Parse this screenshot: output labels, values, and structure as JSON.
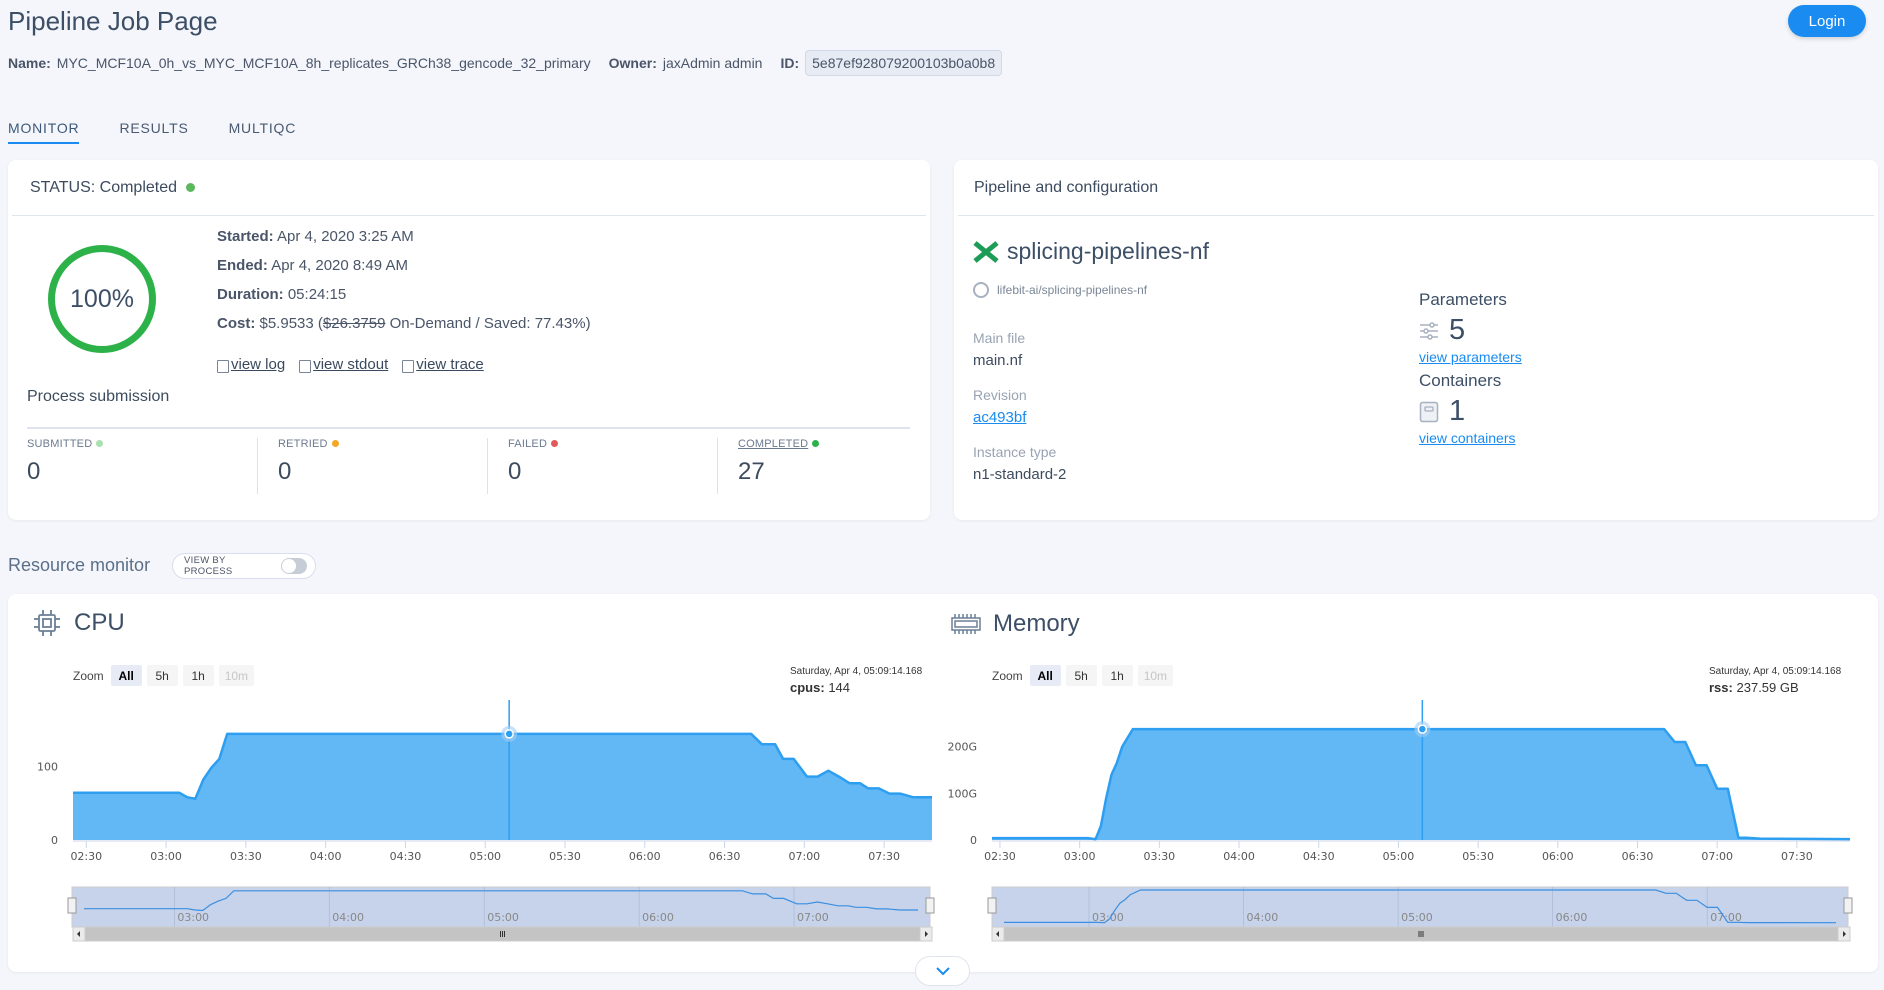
{
  "header": {
    "title": "Pipeline Job Page",
    "name_label": "Name:",
    "name_value": "MYC_MCF10A_0h_vs_MYC_MCF10A_8h_replicates_GRCh38_gencode_32_primary",
    "owner_label": "Owner:",
    "owner_value": "jaxAdmin admin",
    "id_label": "ID:",
    "id_value": "5e87ef928079200103b0a0b8",
    "login_label": "Login"
  },
  "tabs": [
    {
      "label": "MONITOR",
      "active": true
    },
    {
      "label": "RESULTS",
      "active": false
    },
    {
      "label": "MULTIQC",
      "active": false
    }
  ],
  "status": {
    "title": "STATUS: Completed",
    "status_color": "#5cb85c",
    "progress_percent": 100,
    "progress_label": "100%",
    "started_label": "Started:",
    "started_value": "Apr 4, 2020 3:25 AM",
    "ended_label": "Ended:",
    "ended_value": "Apr 4, 2020 8:49 AM",
    "duration_label": "Duration:",
    "duration_value": "05:24:15",
    "cost_label": "Cost:",
    "cost_value": "$5.9533 (",
    "cost_ondemand": "$26.3759",
    "cost_suffix": " On-Demand / Saved: 77.43%)",
    "links": [
      "view log",
      "view stdout",
      "view trace"
    ],
    "process_title": "Process submission",
    "counters": [
      {
        "label": "SUBMITTED",
        "value": "0",
        "color": "#a8e0b0"
      },
      {
        "label": "RETRIED",
        "value": "0",
        "color": "#f5a623"
      },
      {
        "label": "FAILED",
        "value": "0",
        "color": "#e05a5a"
      },
      {
        "label": "COMPLETED",
        "value": "27",
        "color": "#2db24a"
      }
    ]
  },
  "pipeline": {
    "card_title": "Pipeline and configuration",
    "name": "splicing-pipelines-nf",
    "repo": "lifebit-ai/splicing-pipelines-nf",
    "main_file_label": "Main file",
    "main_file_value": "main.nf",
    "revision_label": "Revision",
    "revision_value": "ac493bf",
    "instance_label": "Instance type",
    "instance_value": "n1-standard-2",
    "parameters_title": "Parameters",
    "parameters_count": "5",
    "parameters_link": "view parameters",
    "containers_title": "Containers",
    "containers_count": "1",
    "containers_link": "view containers"
  },
  "resource_monitor": {
    "title": "Resource monitor",
    "view_by_process_label": "VIEW BY PROCESS",
    "view_by_process_on": false,
    "zoom_label": "Zoom",
    "zoom_buttons": [
      "All",
      "5h",
      "1h",
      "10m"
    ],
    "zoom_selected": "All"
  },
  "chart_data": [
    {
      "type": "area",
      "title": "CPU",
      "xlabel": "",
      "ylabel": "",
      "x_ticks": [
        "02:30",
        "03:00",
        "03:30",
        "04:00",
        "04:30",
        "05:00",
        "05:30",
        "06:00",
        "06:30",
        "07:00",
        "07:30"
      ],
      "y_ticks": [
        "0",
        "100"
      ],
      "y_tick_values": [
        0,
        100
      ],
      "ylim": [
        0,
        190
      ],
      "xlim_minutes": [
        145,
        468
      ],
      "x_minutes": [
        145,
        185,
        188,
        191,
        194,
        197,
        200,
        203,
        206,
        212,
        400,
        404,
        409,
        412,
        416,
        421,
        425,
        429,
        433,
        437,
        441,
        444,
        448,
        452,
        456,
        461,
        463,
        468
      ],
      "values": [
        64,
        64,
        58,
        56,
        82,
        98,
        110,
        144,
        144,
        144,
        144,
        130,
        130,
        110,
        110,
        86,
        86,
        94,
        86,
        77,
        77,
        70,
        70,
        63,
        63,
        58,
        58,
        58
      ],
      "tooltip": {
        "date": "Saturday, Apr 4, 05:09:14.168",
        "series": "cpus",
        "value": "144"
      },
      "crosshair_minutes": 309,
      "navigator_ticks": [
        "03:00",
        "04:00",
        "05:00",
        "06:00",
        "07:00"
      ],
      "color": "#2e9ff0",
      "fill": "#62b7f5"
    },
    {
      "type": "area",
      "title": "Memory",
      "xlabel": "",
      "ylabel": "",
      "x_ticks": [
        "02:30",
        "03:00",
        "03:30",
        "04:00",
        "04:30",
        "05:00",
        "05:30",
        "06:00",
        "06:30",
        "07:00",
        "07:30"
      ],
      "y_ticks": [
        "0",
        "100G",
        "200G"
      ],
      "y_tick_values": [
        0,
        100,
        200
      ],
      "ylim": [
        0,
        300
      ],
      "xlim_minutes": [
        147,
        470
      ],
      "x_minutes": [
        147,
        183,
        186,
        188,
        190,
        192,
        194,
        196,
        200,
        203,
        206,
        400,
        404,
        408,
        412,
        416,
        420,
        424,
        428,
        431,
        436,
        470
      ],
      "values": [
        4,
        4,
        2,
        30,
        90,
        140,
        165,
        200,
        237.59,
        237.59,
        237.59,
        237.59,
        210,
        210,
        160,
        160,
        110,
        110,
        5,
        5,
        3,
        2
      ],
      "tooltip": {
        "date": "Saturday, Apr 4, 05:09:14.168",
        "series": "rss",
        "value": "237.59 GB"
      },
      "crosshair_minutes": 309,
      "navigator_ticks": [
        "03:00",
        "04:00",
        "05:00",
        "06:00",
        "07:00"
      ],
      "color": "#2e9ff0",
      "fill": "#62b7f5"
    }
  ]
}
